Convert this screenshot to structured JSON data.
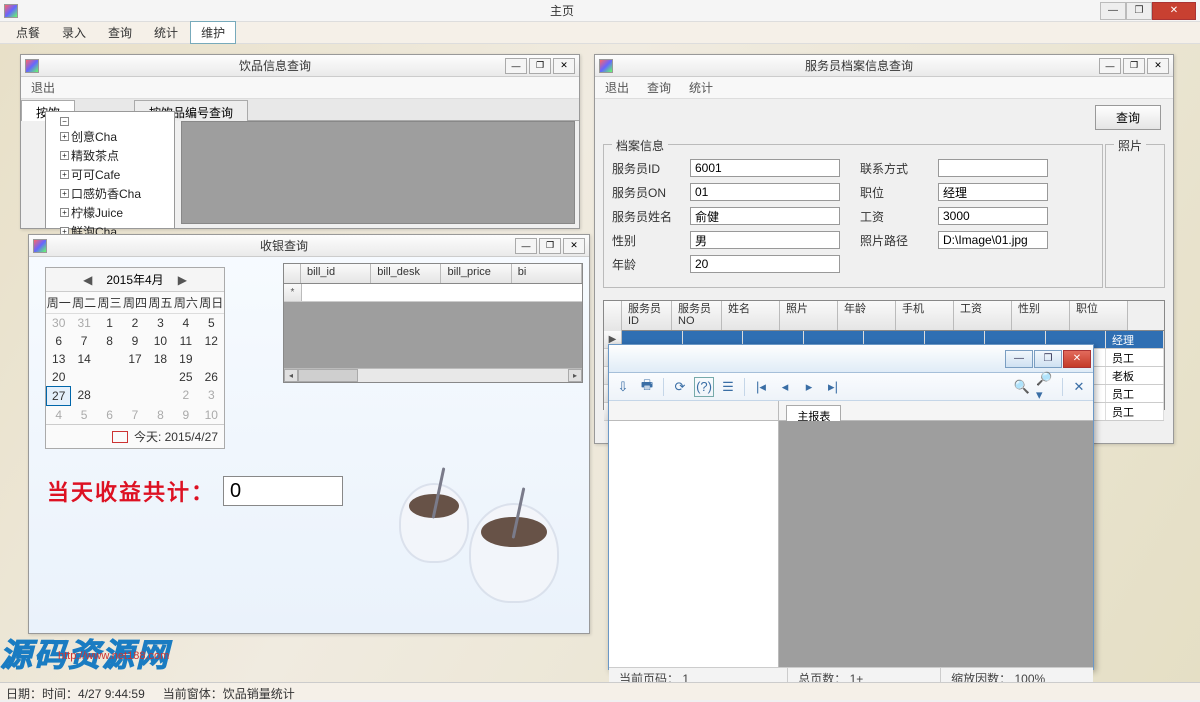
{
  "main": {
    "title": "主页",
    "menus": [
      "点餐",
      "录入",
      "查询",
      "统计",
      "维护"
    ],
    "active_menu_index": 4
  },
  "status": {
    "date_label": "日期：",
    "time_label": "时间：",
    "time_value": "4/27 9:44:59",
    "active_window_label": "当前窗体：",
    "active_window_value": "饮品销量统计"
  },
  "drink_query": {
    "title": "饮品信息查询",
    "menu_exit": "退出",
    "tab1": "按饮",
    "tab2": "按饮品编号查询",
    "tree": [
      "创意Cha",
      "精致茶点",
      "可可Cafe",
      "口感奶香Cha",
      "柠檬Juice",
      "鲜泡Cha"
    ]
  },
  "cashier": {
    "title": "收银查询",
    "calendar": {
      "month_label": "2015年4月",
      "dow": [
        "周一",
        "周二",
        "周三",
        "周四",
        "周五",
        "周六",
        "周日"
      ],
      "today_label": "今天: 2015/4/27",
      "days": [
        {
          "n": "30",
          "o": true
        },
        {
          "n": "31",
          "o": true
        },
        {
          "n": "1"
        },
        {
          "n": "2"
        },
        {
          "n": "3"
        },
        {
          "n": "4"
        },
        {
          "n": "5"
        },
        {
          "n": "6"
        },
        {
          "n": "7"
        },
        {
          "n": "8"
        },
        {
          "n": "9"
        },
        {
          "n": "10"
        },
        {
          "n": "11"
        },
        {
          "n": "12"
        },
        {
          "n": "13"
        },
        {
          "n": "14"
        },
        {
          "n": ""
        },
        {
          "n": "17"
        },
        {
          "n": "18"
        },
        {
          "n": "19"
        },
        {
          "n": ""
        },
        {
          "n": "20"
        },
        {
          "n": ""
        },
        {
          "n": ""
        },
        {
          "n": ""
        },
        {
          "n": ""
        },
        {
          "n": "25"
        },
        {
          "n": "26"
        },
        {
          "n": "27",
          "sel": true
        },
        {
          "n": "28"
        },
        {
          "n": ""
        },
        {
          "n": ""
        },
        {
          "n": ""
        },
        {
          "n": "2",
          "o": true
        },
        {
          "n": "3",
          "o": true
        },
        {
          "n": "4",
          "o": true
        },
        {
          "n": "5",
          "o": true
        },
        {
          "n": "6",
          "o": true
        },
        {
          "n": "7",
          "o": true
        },
        {
          "n": "8",
          "o": true
        },
        {
          "n": "9",
          "o": true
        },
        {
          "n": "10",
          "o": true
        }
      ]
    },
    "grid_cols": [
      "bill_id",
      "bill_desk",
      "bill_price",
      "bi"
    ],
    "revenue_label": "当天收益共计：",
    "revenue_value": "0"
  },
  "waiter": {
    "title": "服务员档案信息查询",
    "menus": [
      "退出",
      "查询",
      "统计"
    ],
    "query_btn": "查询",
    "legend": "档案信息",
    "photo_legend": "照片",
    "fields": {
      "id_label": "服务员ID",
      "id": "6001",
      "on_label": "服务员ON",
      "on": "01",
      "name_label": "服务员姓名",
      "name": "俞健",
      "gender_label": "性别",
      "gender": "男",
      "age_label": "年龄",
      "age": "20",
      "contact_label": "联系方式",
      "contact": "",
      "position_label": "职位",
      "position": "经理",
      "salary_label": "工资",
      "salary": "3000",
      "photo_path_label": "照片路径",
      "photo_path": "D:\\Image\\01.jpg"
    },
    "grid_cols": [
      "服务员ID",
      "服务员NO",
      "姓名",
      "照片",
      "年龄",
      "手机",
      "工资",
      "性别",
      "职位"
    ],
    "grid_position_col": [
      "经理",
      "员工",
      "老板",
      "员工",
      "员工"
    ]
  },
  "report": {
    "tab": "主报表",
    "s_page_label": "当前页码：",
    "s_page": "1",
    "s_total_label": "总页数：",
    "s_total": "1+",
    "s_zoom_label": "缩放因数：",
    "s_zoom": "100%"
  },
  "watermark": "源码资源网",
  "watermark_url": "http://www.net188.com"
}
